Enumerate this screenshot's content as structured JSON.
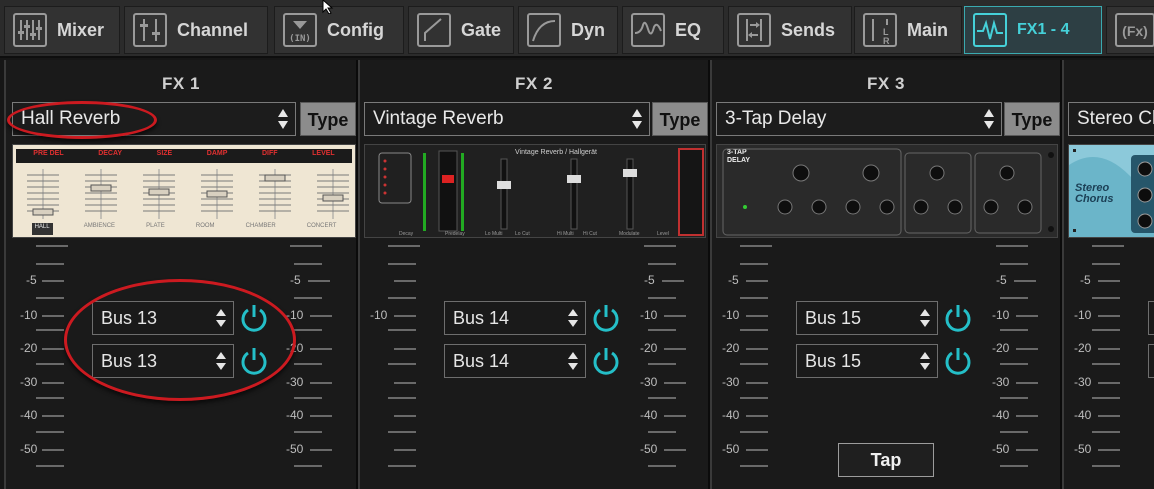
{
  "tabs": [
    {
      "label": "Mixer",
      "icon": "mixer-faders-icon",
      "active": false
    },
    {
      "label": "Channel",
      "icon": "channel-strip-icon",
      "active": false
    },
    {
      "label": "Config",
      "icon": "config-input-icon",
      "active": false
    },
    {
      "label": "Gate",
      "icon": "gate-curve-icon",
      "active": false
    },
    {
      "label": "Dyn",
      "icon": "dynamics-curve-icon",
      "active": false
    },
    {
      "label": "EQ",
      "icon": "eq-curve-icon",
      "active": false
    },
    {
      "label": "Sends",
      "icon": "sends-icon",
      "active": false
    },
    {
      "label": "Main",
      "icon": "main-lr-icon",
      "active": false
    },
    {
      "label": "FX1 - 4",
      "icon": "fx-wave-icon",
      "active": true
    },
    {
      "label": "",
      "icon": "fx-more-icon",
      "active": false,
      "icon_text": "(Fx)"
    }
  ],
  "fx_panels": [
    {
      "title": "FX 1",
      "effect": "Hall Reverb",
      "type_label": "Type",
      "bus_a": "Bus 13",
      "bus_b": "Bus 13",
      "thumb": "hall-reverb-faceplate",
      "faceplate_labels": [
        "PRE DEL",
        "DECAY",
        "SIZE",
        "DAMP",
        "DIFF",
        "LEVEL"
      ],
      "faceplate_buttons": [
        "HALL",
        "AMBIENCE",
        "PLATE",
        "ROOM",
        "CHAMBER",
        "CONCERT"
      ]
    },
    {
      "title": "FX 2",
      "effect": "Vintage Reverb",
      "type_label": "Type",
      "bus_a": "Bus 14",
      "bus_b": "Bus 14",
      "thumb": "vintage-reverb-faceplate",
      "faceplate_title": "Vintage Reverb / Hallgerät"
    },
    {
      "title": "FX 3",
      "effect": "3-Tap Delay",
      "type_label": "Type",
      "bus_a": "Bus 15",
      "bus_b": "Bus 15",
      "tap_label": "Tap",
      "thumb": "3-tap-delay-faceplate",
      "faceplate_title": "3-TAP DELAY"
    },
    {
      "title": "",
      "effect": "Stereo Ch",
      "type_label": "",
      "thumb": "stereo-chorus-faceplate",
      "faceplate_title": "Stereo Chorus"
    }
  ],
  "scale_labels": [
    "-5",
    "-10",
    "-20",
    "-30",
    "-40",
    "-50"
  ],
  "colors": {
    "accent": "#45d1d9",
    "highlight_ring": "#cc1a20",
    "background": "#161616"
  }
}
